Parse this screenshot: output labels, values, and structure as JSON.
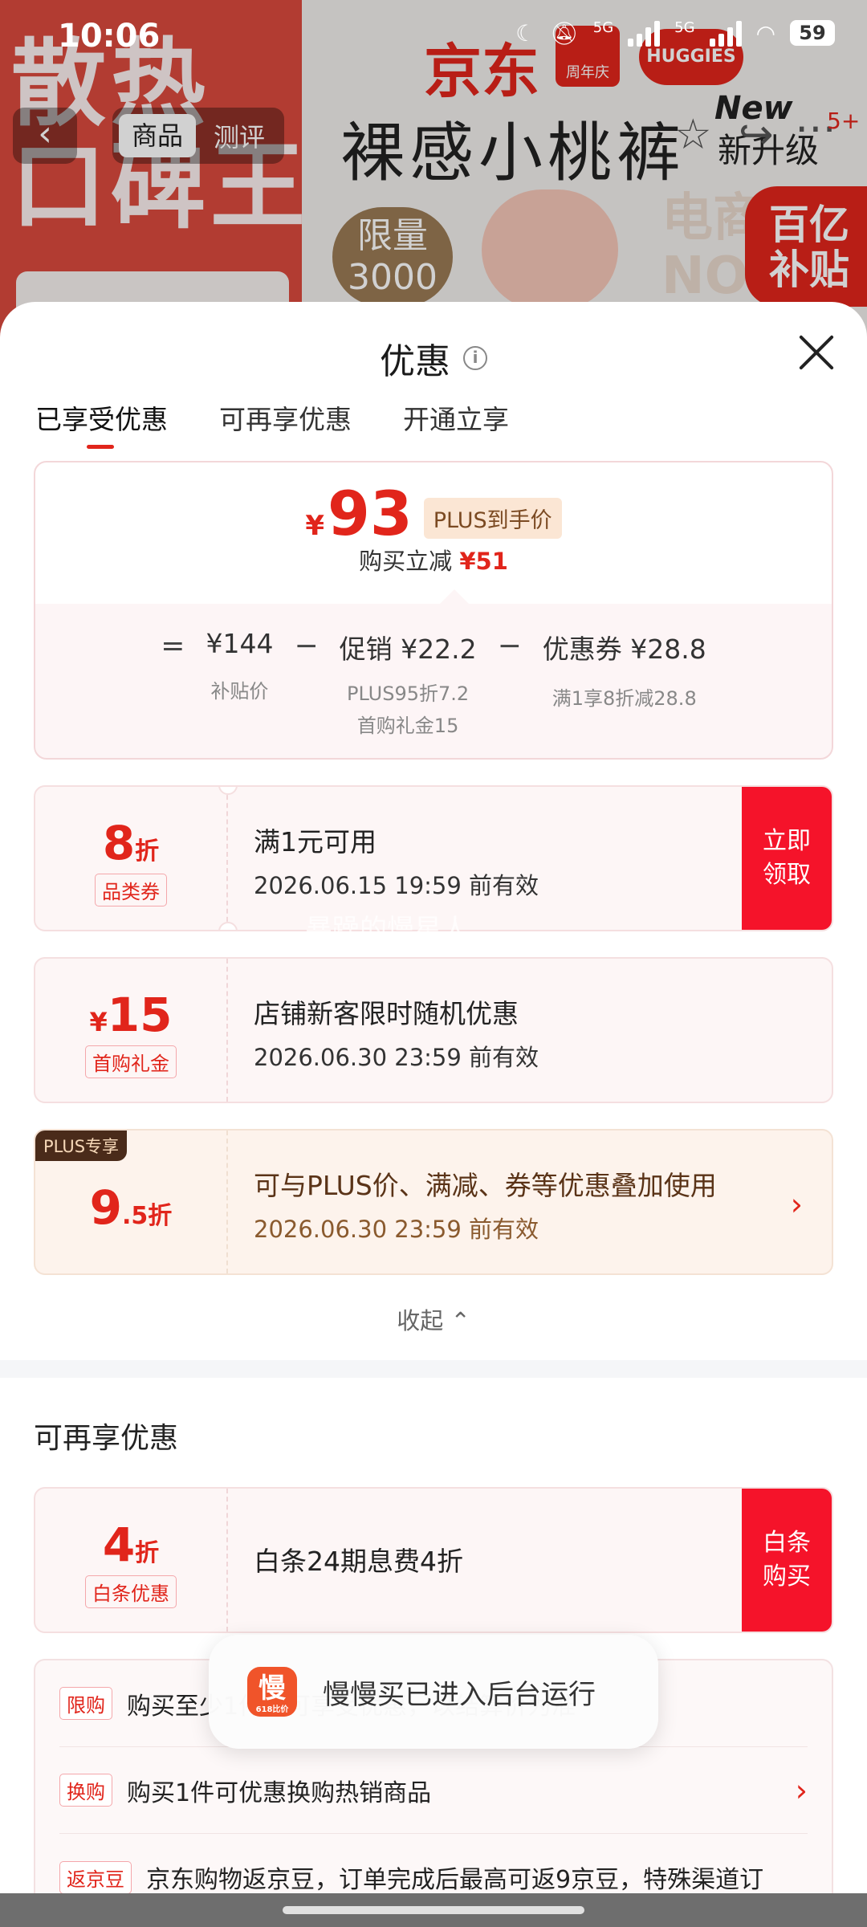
{
  "status_bar": {
    "time": "10:06",
    "net1": "5G",
    "net2": "5G",
    "battery": "59"
  },
  "background": {
    "left_text_1": "散热",
    "left_text_2": "口碑王",
    "brand_jd": "京东",
    "anniversary": "周年庆",
    "brand_huggies": "HUGGIES",
    "product_title": "裸感小桃裤",
    "new_text": "New",
    "upgrade_text": "新升级",
    "limit_text_1": "限量",
    "limit_text_2": "3000",
    "ec_text_1": "电商",
    "ec_text_2": "NO",
    "subsidy_1": "百亿",
    "subsidy_2": "补贴",
    "seg_active": "商品",
    "seg_inactive": "测评",
    "badge": "5+"
  },
  "sheet": {
    "title": "优惠",
    "tabs": [
      "已享受优惠",
      "可再享优惠",
      "开通立享"
    ],
    "summary": {
      "yen": "¥",
      "price": "93",
      "price_tag": "PLUS到手价",
      "sub_label": "购买立减",
      "sub_value": "¥51",
      "eq": "=",
      "minus": "−",
      "base_price": "¥144",
      "base_note": "补贴价",
      "promo_main": "促销 ¥22.2",
      "promo_note_1": "PLUS95折7.2",
      "promo_note_2": "首购礼金15",
      "coupon_main": "优惠券 ¥28.8",
      "coupon_note": "满1享8折减28.8"
    },
    "coupons": [
      {
        "big": "8",
        "unit": "折",
        "label": "品类券",
        "title": "满1元可用",
        "date": "2026.06.15 19:59 前有效",
        "button": "立即领取"
      },
      {
        "yen": "¥",
        "big": "15",
        "label": "首购礼金",
        "title": "店铺新客限时随机优惠",
        "date": "2026.06.30 23:59 前有效"
      },
      {
        "plus_tag": "PLUS专享",
        "big": "9",
        "unit": ".5折",
        "title": "可与PLUS价、满减、券等优惠叠加使用",
        "date": "2026.06.30 23:59 前有效"
      }
    ],
    "collapse_label": "收起",
    "section_title": "可再享优惠",
    "baitiao": {
      "big": "4",
      "unit": "折",
      "label": "白条优惠",
      "title": "白条24期息费4折",
      "button": "白条购买"
    },
    "promos": [
      {
        "tag": "限购",
        "text": "购买至少1件时可享受优惠，以结算价为准"
      },
      {
        "tag": "换购",
        "text": "购买1件可优惠换购热销商品"
      },
      {
        "tag": "返京豆",
        "text": "京东购物返京豆，订单完成后最高可返9京豆，特殊渠道订"
      }
    ]
  },
  "watermark": "暴躁的慢星人",
  "toast": {
    "icon_text": "慢",
    "icon_sub": "618比价",
    "text": "慢慢买已进入后台运行"
  },
  "colors": {
    "accent": "#e1251b",
    "button": "#f5132a",
    "plus_dark": "#4a2b1a"
  }
}
